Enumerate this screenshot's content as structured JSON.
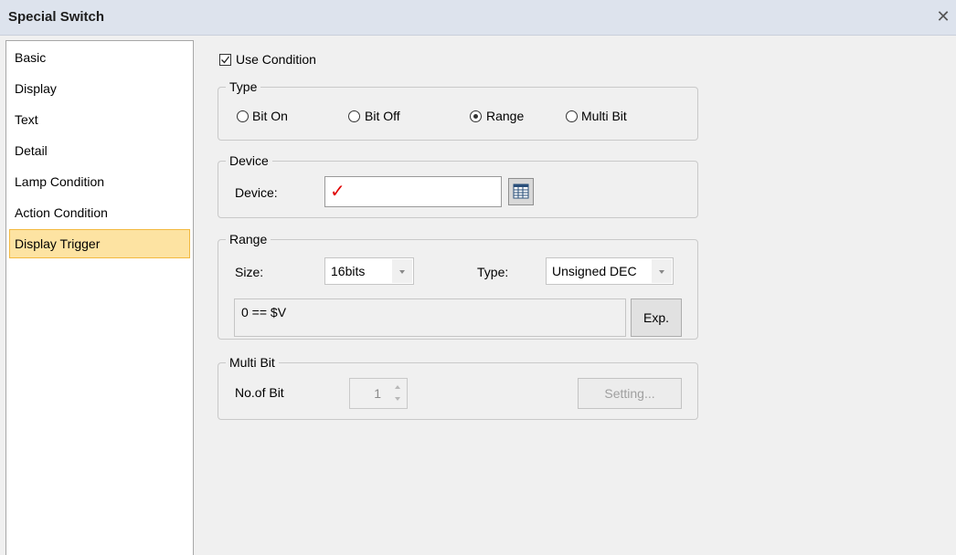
{
  "window": {
    "title": "Special Switch",
    "close_icon": "close-icon"
  },
  "sidebar": {
    "items": [
      {
        "label": "Basic"
      },
      {
        "label": "Display"
      },
      {
        "label": "Text"
      },
      {
        "label": "Detail"
      },
      {
        "label": "Lamp Condition"
      },
      {
        "label": "Action Condition"
      },
      {
        "label": "Display Trigger",
        "selected": true
      }
    ]
  },
  "use_condition": {
    "label": "Use Condition",
    "checked": true
  },
  "type_group": {
    "title": "Type",
    "options": [
      {
        "label": "Bit On",
        "selected": false
      },
      {
        "label": "Bit Off",
        "selected": false
      },
      {
        "label": "Range",
        "selected": true
      },
      {
        "label": "Multi Bit",
        "selected": false
      }
    ]
  },
  "device_group": {
    "title": "Device",
    "device_label": "Device:",
    "device_value": "✓",
    "picker_icon": "device-picker-icon"
  },
  "range_group": {
    "title": "Range",
    "size_label": "Size:",
    "size_value": "16bits",
    "type_label": "Type:",
    "type_value": "Unsigned DEC",
    "expression": "0 == $V",
    "exp_button": "Exp."
  },
  "multibit_group": {
    "title": "Multi Bit",
    "no_of_bit_label": "No.of Bit",
    "no_of_bit_value": "1",
    "setting_button": "Setting..."
  },
  "colors": {
    "selection_bg": "#fde3a2",
    "selection_border": "#f3b940",
    "title_bar": "#dde3ed",
    "device_mark": "#e00000"
  }
}
